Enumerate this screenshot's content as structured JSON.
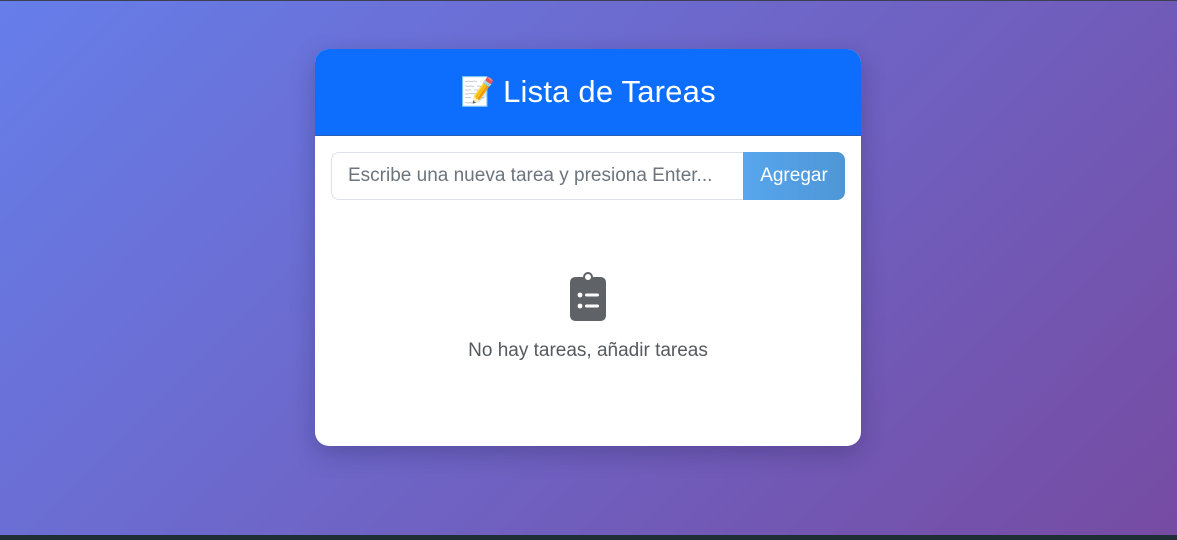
{
  "header": {
    "emoji": "📝",
    "title": "Lista de Tareas"
  },
  "task_form": {
    "placeholder": "Escribe una nueva tarea y presiona Enter...",
    "value": "",
    "add_label": "Agregar"
  },
  "empty_state": {
    "icon": "clipboard-list-icon",
    "message": "No hay tareas, añadir tareas"
  },
  "colors": {
    "background_start": "#667eea",
    "background_end": "#764ba2",
    "header": "#0d6efd",
    "button": "#58a6ee",
    "icon": "#5f6368"
  },
  "tasks": []
}
